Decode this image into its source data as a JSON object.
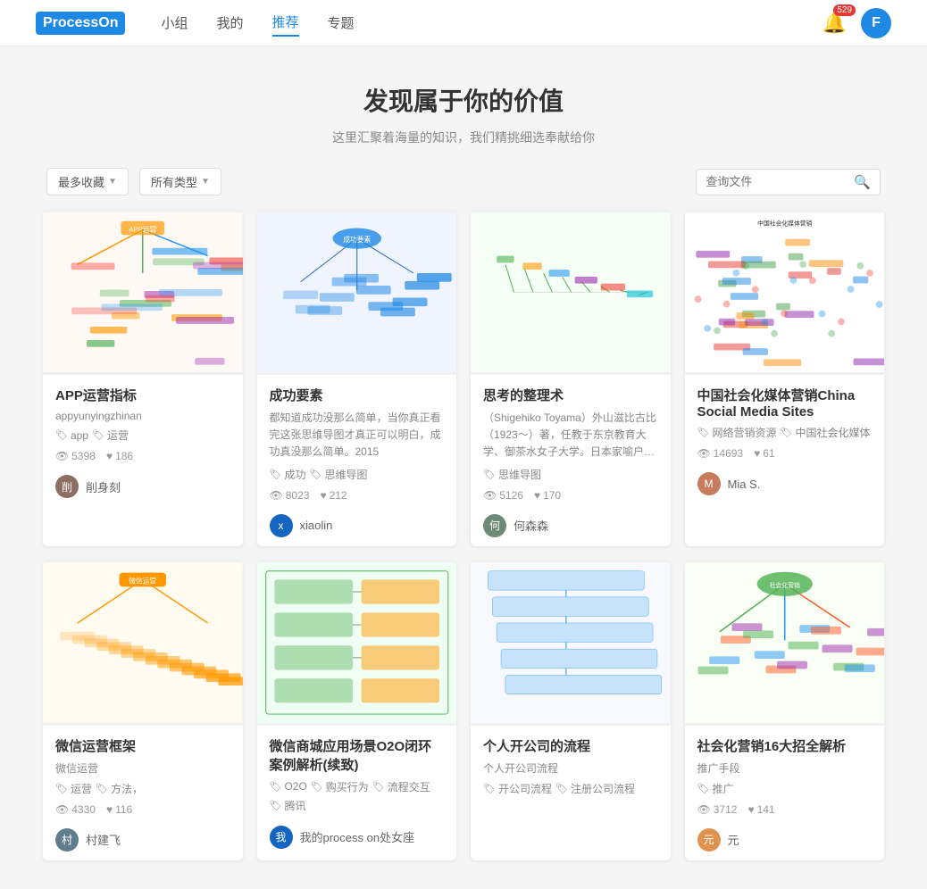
{
  "header": {
    "logo_text": "ProcessOn",
    "logo_short": "Process",
    "logo_on": "On",
    "nav": [
      {
        "label": "小组",
        "active": false
      },
      {
        "label": "我的",
        "active": false
      },
      {
        "label": "推荐",
        "active": true
      },
      {
        "label": "专题",
        "active": false
      }
    ],
    "notification_count": "529",
    "avatar_letter": "F"
  },
  "hero": {
    "title": "发现属于你的价值",
    "subtitle": "这里汇聚着海量的知识，我们精挑细选奉献给你"
  },
  "toolbar": {
    "sort_label": "最多收藏",
    "type_label": "所有类型",
    "search_placeholder": "查询文件"
  },
  "cards": [
    {
      "id": "card-1",
      "title": "APP运营指标",
      "author_name": "appyunyingzhinan",
      "tags": [
        "app",
        "运营"
      ],
      "views": "5398",
      "likes": "186",
      "user_name": "削身刻",
      "user_avatar_color": "#8d6e63",
      "thumb_color_scheme": "multicolor"
    },
    {
      "id": "card-2",
      "title": "成功要素",
      "desc": "都知道成功没那么简单，当你真正看完这张思维导图才真正可以明白，成功真没那么简单。2015",
      "tags": [
        "成功",
        "思维导图"
      ],
      "views": "8023",
      "likes": "212",
      "user_name": "xiaolin",
      "user_avatar_color": "#1565c0",
      "thumb_color_scheme": "blue"
    },
    {
      "id": "card-3",
      "title": "思考的整理术",
      "desc": "（Shigehiko Toyama）外山滋比古比（1923～）著，任教于东京教育大学、御茶水女子大学。日本家喻户晓的语言..",
      "tags": [
        "思维导图"
      ],
      "views": "5126",
      "likes": "170",
      "user_name": "何森森",
      "user_avatar_color": "#6d8b74",
      "thumb_color_scheme": "green"
    },
    {
      "id": "card-4",
      "title": "中国社会化媒体营销China Social Media Sites",
      "tags": [
        "网络营销资源",
        "中国社会化媒体"
      ],
      "views": "14693",
      "likes": "61",
      "user_name": "Mia S.",
      "user_avatar_color": "#c77c5e",
      "thumb_color_scheme": "complex"
    },
    {
      "id": "card-5",
      "title": "微信运营框架",
      "author_name": "微信运营",
      "tags": [
        "运营",
        "方法，"
      ],
      "views": "4330",
      "likes": "116",
      "user_name": "村建飞",
      "user_avatar_color": "#607d8b",
      "thumb_color_scheme": "orange"
    },
    {
      "id": "card-6",
      "title": "微信商城应用场景O2O闭环案例解析(续致)",
      "tags": [
        "O2O",
        "购买行为",
        "流程交互",
        "腾讯"
      ],
      "views": "",
      "likes": "",
      "user_name": "我的process on处女座",
      "user_avatar_color": "#1565c0",
      "thumb_color_scheme": "flow"
    },
    {
      "id": "card-7",
      "title": "个人开公司的流程",
      "author_name": "个人开公司流程",
      "tags": [
        "开公司流程",
        "注册公司流程"
      ],
      "views": "",
      "likes": "",
      "user_name": "",
      "user_avatar_color": "#888",
      "thumb_color_scheme": "flowchart"
    },
    {
      "id": "card-8",
      "title": "社会化营销16大招全解析",
      "author_name": "推广手段",
      "tags": [
        "推广"
      ],
      "views": "3712",
      "likes": "141",
      "user_name": "元",
      "user_avatar_color": "#e0934e",
      "thumb_color_scheme": "multicolor2"
    }
  ]
}
